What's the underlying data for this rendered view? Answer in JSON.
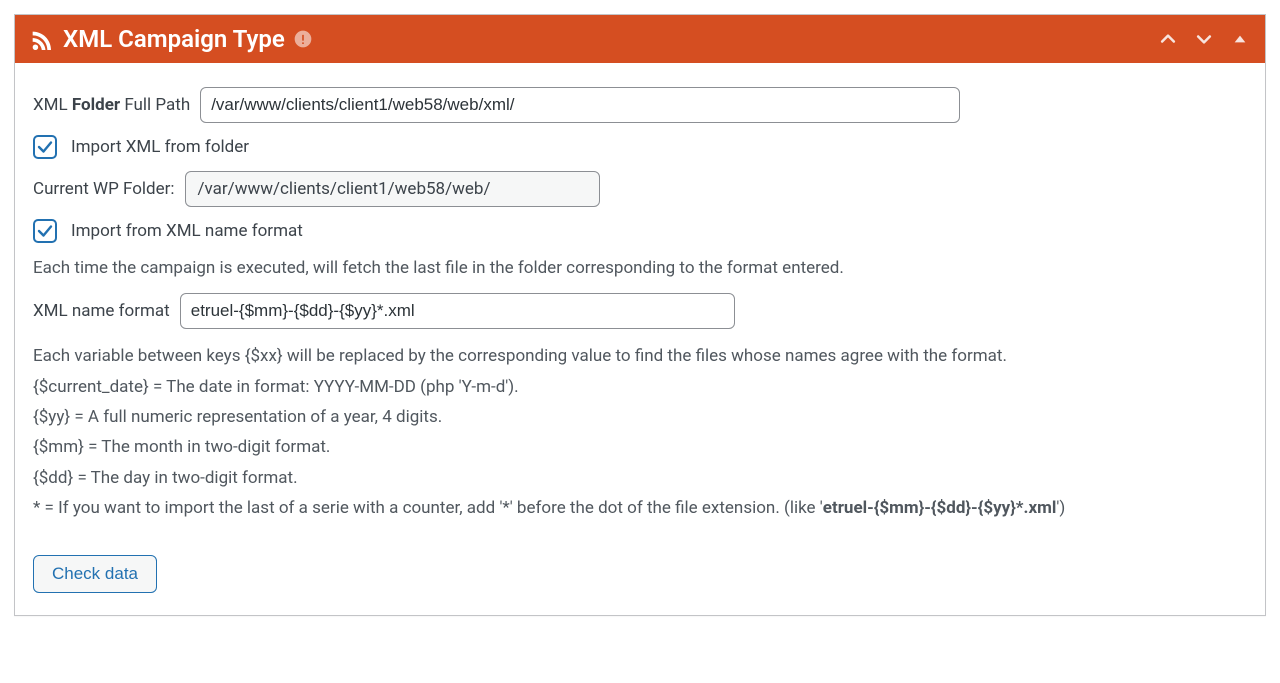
{
  "header": {
    "title": "XML Campaign Type",
    "icons": {
      "rss": "rss-icon",
      "warn": "alert-circle-icon"
    }
  },
  "labels": {
    "xml_folder_pre": "XML ",
    "xml_folder_bold": "Folder",
    "xml_folder_post": " Full Path",
    "import_from_folder": "Import XML from folder",
    "current_wp_folder": "Current WP Folder:",
    "import_from_name_format": "Import from XML name format",
    "xml_name_format": "XML name format",
    "check_data": "Check data"
  },
  "values": {
    "xml_folder_path": "/var/www/clients/client1/web58/web/xml/",
    "current_wp_folder": "/var/www/clients/client1/web58/web/",
    "xml_name_format": "etruel-{$mm}-{$dd}-{$yy}*.xml",
    "import_from_folder_checked": true,
    "import_from_name_checked": true
  },
  "help": {
    "each_time": "Each time the campaign is executed, will fetch the last file in the folder corresponding to the format entered.",
    "vars_intro": "Each variable between keys {$xx} will be replaced by the corresponding value to find the files whose names agree with the format.",
    "var_current_date": "{$current_date} = The date in format: YYYY-MM-DD (php 'Y-m-d').",
    "var_yy": "{$yy} = A full numeric representation of a year, 4 digits.",
    "var_mm": "{$mm} = The month in two-digit format.",
    "var_dd": "{$dd} = The day in two-digit format.",
    "star_pre": "* = If you want to import the last of a serie with a counter, add '*' before the dot of the file extension. (like '",
    "star_bold": "etruel-{$mm}-{$dd}-{$yy}*.xml",
    "star_post": "')"
  }
}
